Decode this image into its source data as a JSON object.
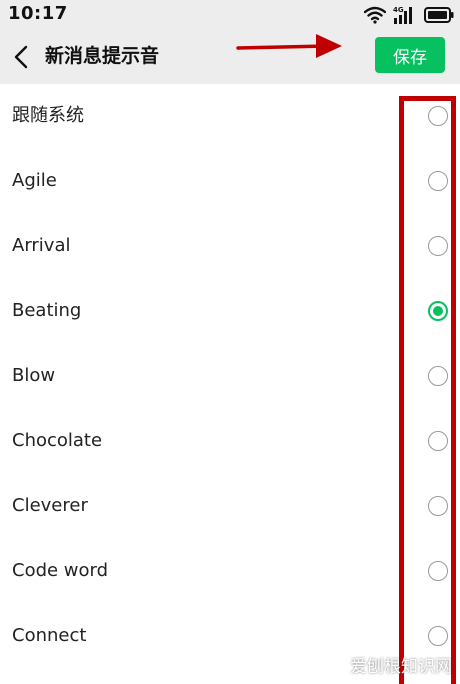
{
  "status_bar": {
    "time": "10:17",
    "network_label": "4G",
    "icons": [
      "wifi-icon",
      "signal-icon",
      "battery-icon"
    ]
  },
  "header": {
    "title": "新消息提示音",
    "save_label": "保存",
    "back_icon": "chevron-left-icon"
  },
  "sounds": [
    {
      "label": "跟随系统",
      "selected": false
    },
    {
      "label": "Agile",
      "selected": false
    },
    {
      "label": "Arrival",
      "selected": false
    },
    {
      "label": "Beating",
      "selected": true
    },
    {
      "label": "Blow",
      "selected": false
    },
    {
      "label": "Chocolate",
      "selected": false
    },
    {
      "label": "Cleverer",
      "selected": false
    },
    {
      "label": "Code word",
      "selected": false
    },
    {
      "label": "Connect",
      "selected": false
    }
  ],
  "watermark": {
    "text": "爱刨根知识网"
  },
  "colors": {
    "accent": "#07c160",
    "header_bg": "#ededed",
    "annotation": "#c00000"
  }
}
